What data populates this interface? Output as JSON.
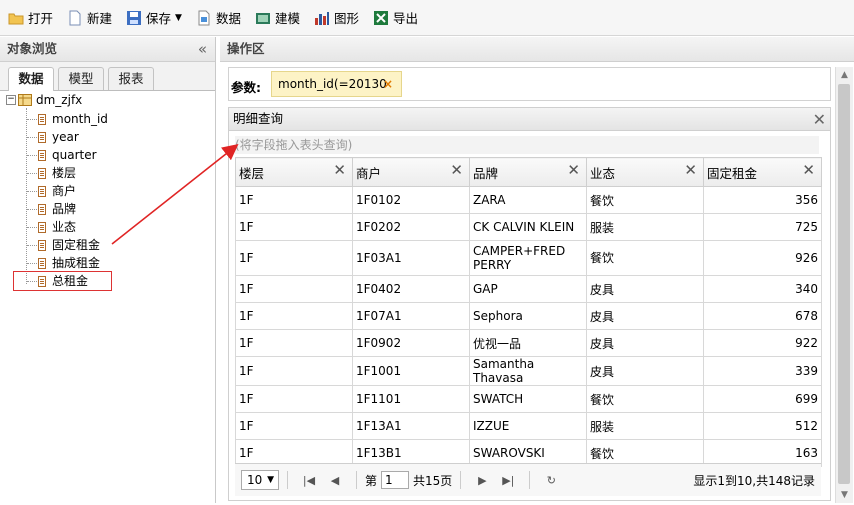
{
  "toolbar": {
    "open": "打开",
    "new": "新建",
    "save": "保存",
    "data": "数据",
    "model": "建模",
    "chart": "图形",
    "export": "导出"
  },
  "left_panel": {
    "title": "对象浏览",
    "collapse": "«",
    "tabs": [
      "数据",
      "模型",
      "报表"
    ],
    "tree_root": "dm_zjfx",
    "tree_items": [
      "month_id",
      "year",
      "quarter",
      "楼层",
      "商户",
      "品牌",
      "业态",
      "固定租金",
      "抽成租金",
      "总租金"
    ]
  },
  "right_panel": {
    "title": "操作区",
    "params_label": "参数:",
    "param_chip": "month_id(=20130",
    "detail_title": "明细查询",
    "drop_hint": "(将字段拖入表头查询)",
    "columns": [
      "楼层",
      "商户",
      "品牌",
      "业态",
      "固定租金"
    ],
    "rows": [
      [
        "1F",
        "1F0102",
        "ZARA",
        "餐饮",
        "356"
      ],
      [
        "1F",
        "1F0202",
        "CK CALVIN KLEIN",
        "服装",
        "725"
      ],
      [
        "1F",
        "1F03A1",
        "CAMPER+FRED PERRY",
        "餐饮",
        "926"
      ],
      [
        "1F",
        "1F0402",
        "GAP",
        "皮具",
        "340"
      ],
      [
        "1F",
        "1F07A1",
        "Sephora",
        "皮具",
        "678"
      ],
      [
        "1F",
        "1F0902",
        "优视一品",
        "皮具",
        "922"
      ],
      [
        "1F",
        "1F1001",
        "Samantha Thavasa",
        "皮具",
        "339"
      ],
      [
        "1F",
        "1F1101",
        "SWATCH",
        "餐饮",
        "699"
      ],
      [
        "1F",
        "1F13A1",
        "IZZUE",
        "服装",
        "512"
      ],
      [
        "1F",
        "1F13B1",
        "SWAROVSKI",
        "餐饮",
        "163"
      ]
    ],
    "pager": {
      "page_size": "10",
      "page_prefix": "第",
      "page_value": "1",
      "page_suffix": "共15页",
      "info": "显示1到10,共148记录"
    }
  }
}
